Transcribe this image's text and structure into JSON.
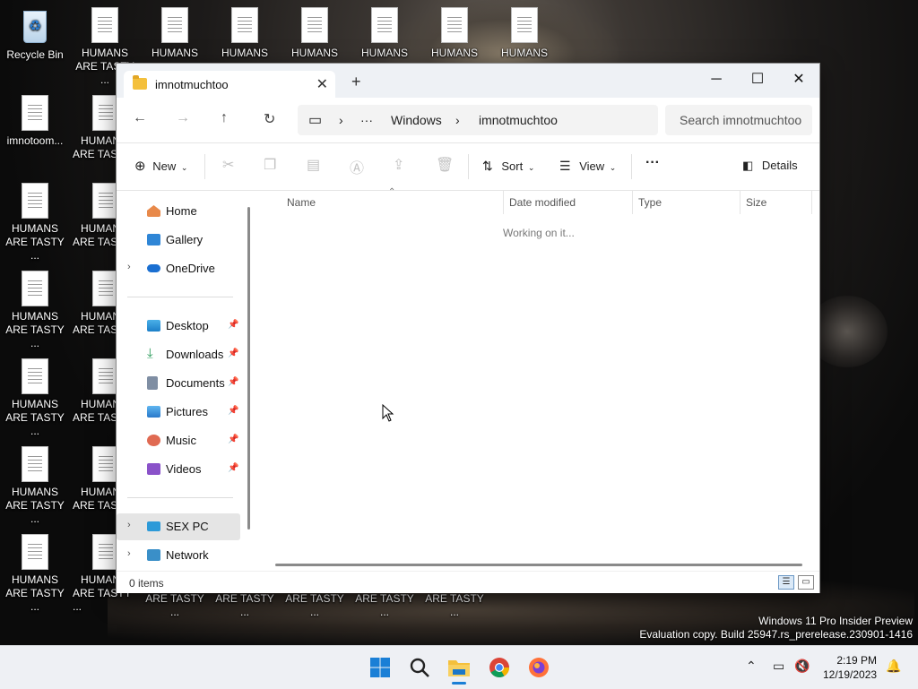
{
  "desktop": {
    "recycle_bin": "Recycle Bin",
    "row_top": [
      {
        "line1": "HUMANS",
        "line2": "ARE TASTY ..."
      },
      {
        "line1": "HUMANS",
        "line2": ""
      },
      {
        "line1": "HUMANS",
        "line2": ""
      },
      {
        "line1": "HUMANS",
        "line2": ""
      },
      {
        "line1": "HUMANS",
        "line2": ""
      },
      {
        "line1": "HUMANS",
        "line2": ""
      },
      {
        "line1": "HUMANS",
        "line2": ""
      }
    ],
    "col_icon_file": "imnotoom...",
    "left_column": [
      {
        "line1": "HUMANS",
        "line2": "ARE TASTY ..."
      },
      {
        "line1": "HUMANS",
        "line2": "ARE TASTY ..."
      },
      {
        "line1": "HUMANS",
        "line2": "ARE TASTY ..."
      },
      {
        "line1": "HUMANS",
        "line2": "ARE TASTY ..."
      },
      {
        "line1": "HUMANS",
        "line2": "ARE TASTY ..."
      }
    ],
    "second_column": [
      {
        "line1": "HUMAN",
        "line2": "ARE TAS"
      },
      {
        "line1": "HUMAN",
        "line2": "ARE TAS"
      },
      {
        "line1": "HUMAN",
        "line2": "ARE TAS"
      },
      {
        "line1": "HUMAN",
        "line2": "ARE TAS"
      },
      {
        "line1": "HUMAN",
        "line2": "ARE TAS"
      },
      {
        "line1": "HUMAN",
        "line2": "ARE TASTY ..."
      }
    ],
    "bottom_labels": [
      "ARE TASTY ...",
      "ARE TASTY ...",
      "ARE TASTY ...",
      "ARE TASTY ...",
      "ARE TASTY ..."
    ]
  },
  "window": {
    "tab_title": "imnotmuchtoo",
    "new_tab": "+",
    "minimize": "─",
    "maximize": "☐",
    "close": "✕",
    "tab_close": "✕"
  },
  "address": {
    "back": "←",
    "forward": "→",
    "up": "↑",
    "refresh": "↻",
    "pc_icon": "▭",
    "chev1": "›",
    "ellipsis": "···",
    "crumb1": "Windows",
    "chev2": "›",
    "crumb2": "imnotmuchtoo",
    "search_placeholder": "Search imnotmuchtoo"
  },
  "commands": {
    "new": "New",
    "sort": "Sort",
    "view": "View",
    "more": "···",
    "details": "Details"
  },
  "nav": {
    "home": "Home",
    "gallery": "Gallery",
    "onedrive": "OneDrive",
    "desktop": "Desktop",
    "downloads": "Downloads",
    "documents": "Documents",
    "pictures": "Pictures",
    "music": "Music",
    "videos": "Videos",
    "this_pc": "SEX PC",
    "network": "Network"
  },
  "columns": {
    "name": "Name",
    "date": "Date modified",
    "type": "Type",
    "size": "Size",
    "working": "Working on it..."
  },
  "status": {
    "items": "0 items"
  },
  "watermark": {
    "line1": "Windows 11 Pro Insider Preview",
    "line2": "Evaluation copy. Build 25947.rs_prerelease.230901-1416"
  },
  "clock": {
    "time": "2:19 PM",
    "date": "12/19/2023"
  }
}
